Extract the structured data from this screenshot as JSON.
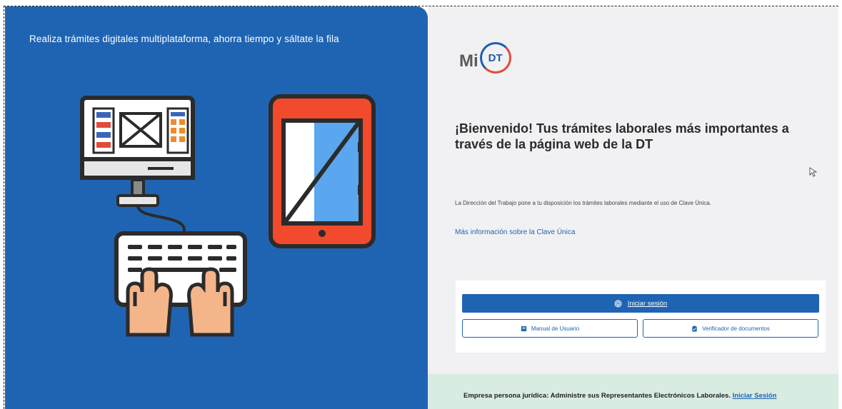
{
  "left": {
    "tagline": "Realiza trámites digitales multiplataforma, ahorra tiempo y sáltate la fila"
  },
  "logo": {
    "prefix": "Mi",
    "badge": "DT"
  },
  "welcome": {
    "title": "¡Bienvenido! Tus trámites laborales más importantes a través de la página web de la DT",
    "intro": "La Dirección del Trabajo pone a tu disposición los trámites laborales mediante el uso de Clave Única.",
    "more_info_link": "Más información sobre la Clave Única"
  },
  "actions": {
    "login_label": "Iniciar sesión",
    "manual_label": "Manual de Usuario",
    "verifier_label": "Verificador de documentos"
  },
  "footer": {
    "text": "Empresa persona jurídica: Administre sus Representantes Electrónicos Laborales.",
    "link": "Iniciar Sesión"
  },
  "colors": {
    "brand_blue": "#1f64b3",
    "accent_red": "#e24b3b",
    "footer_green": "#d8ece2"
  },
  "icons": {
    "login": "fingerprint-icon",
    "manual": "book-icon",
    "verifier": "clipboard-check-icon"
  }
}
